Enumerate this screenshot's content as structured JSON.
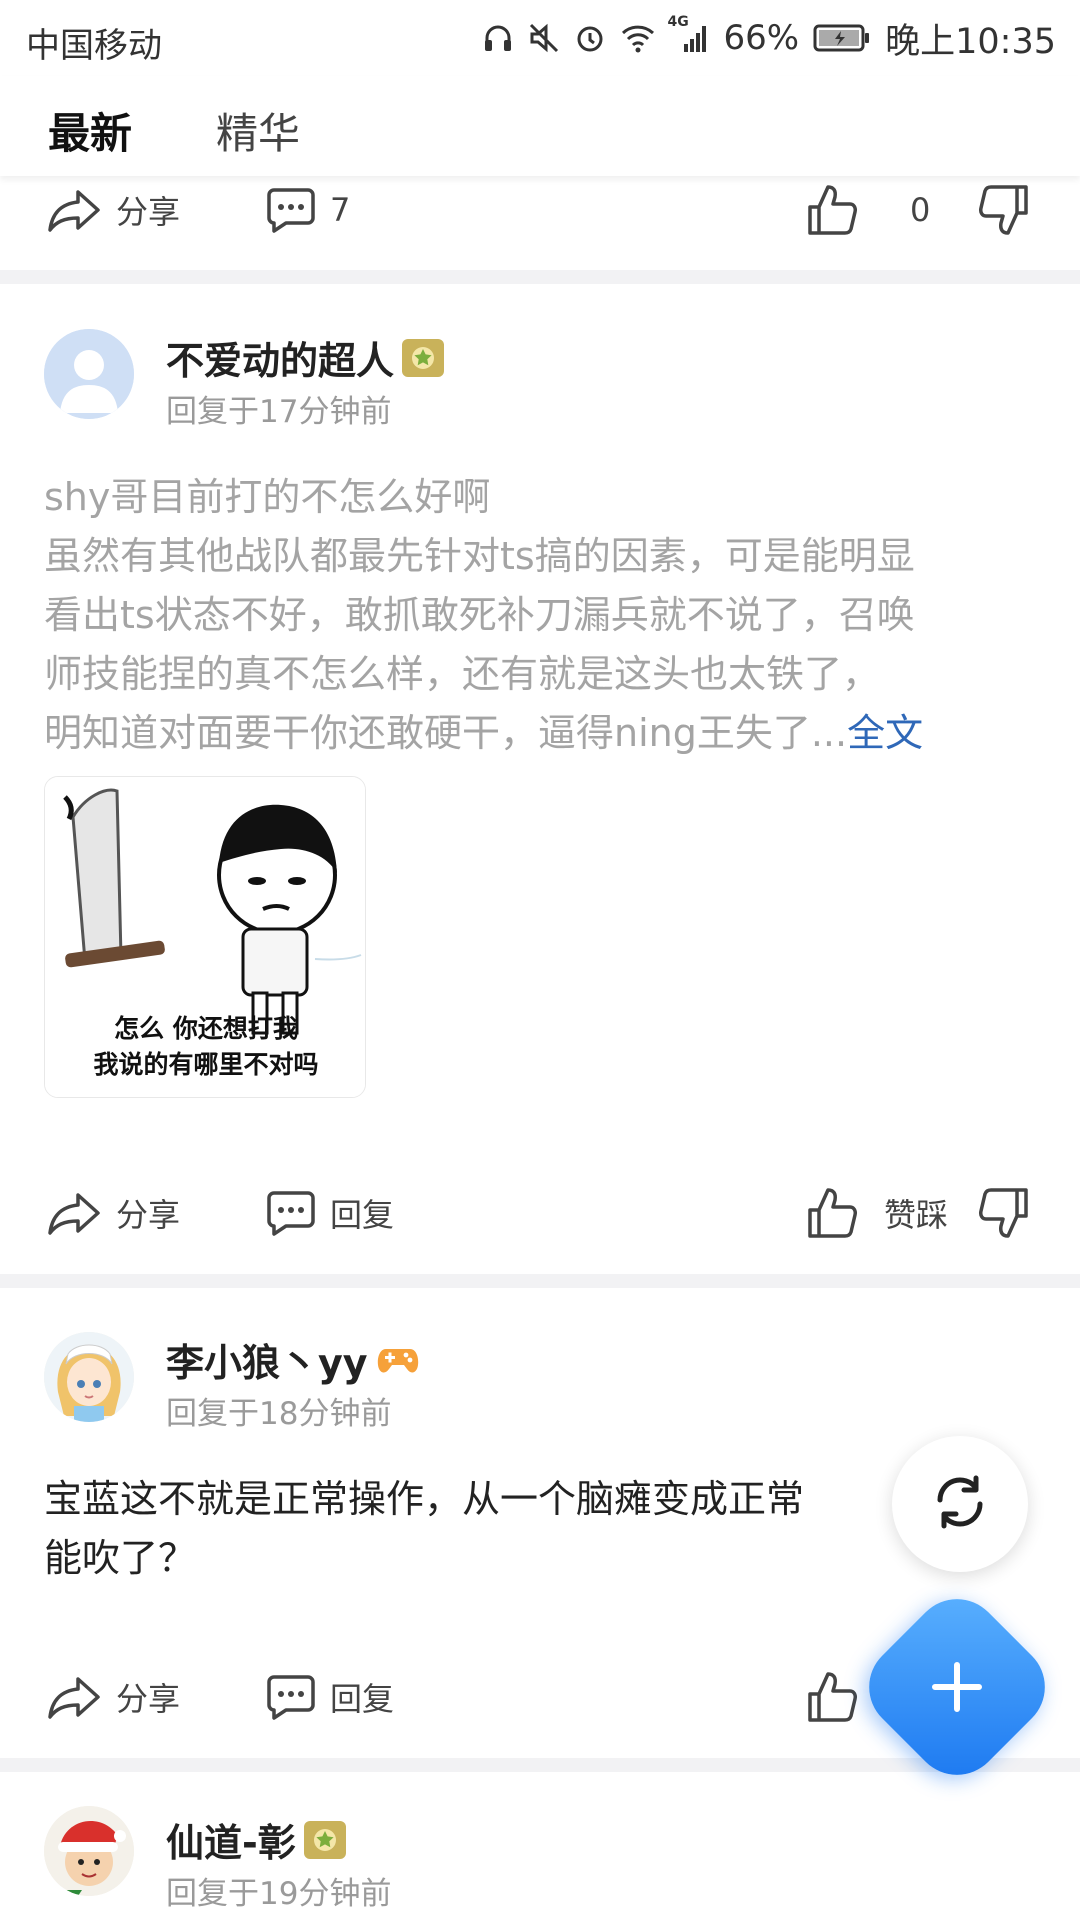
{
  "status_bar": {
    "carrier": "中国移动",
    "network": "4G",
    "battery": "66%",
    "time": "晚上10:35"
  },
  "tabs": [
    {
      "label": "最新",
      "active": true
    },
    {
      "label": "精华",
      "active": false
    }
  ],
  "prev_post_actions": {
    "share_label": "分享",
    "comment_count": "7",
    "like_count": "0"
  },
  "posts": [
    {
      "username": "不爱动的超人",
      "timestamp": "回复于17分钟前",
      "text_lines": [
        "shy哥目前打的不怎么好啊",
        "虽然有其他战队都最先针对ts搞的因素，可是能明显",
        "看出ts状态不好，敢抓敢死补刀漏兵就不说了，召唤",
        "师技能捏的真不怎么样，还有就是这头也太铁了，",
        "明知道对面要干你还敢硬干，逼得ning王失了..."
      ],
      "more_link": "全文",
      "image_caption": [
        "怎么 你还想打我",
        "我说的有哪里不对吗"
      ],
      "actions": {
        "share_label": "分享",
        "reply_label": "回复",
        "vote_label": "赞踩"
      }
    },
    {
      "username": "李小狼丶yy",
      "timestamp": "回复于18分钟前",
      "text_lines": [
        "宝蓝这不就是正常操作，从一个脑瘫变成正常",
        "能吹了？"
      ],
      "actions": {
        "share_label": "分享",
        "reply_label": "回复"
      }
    },
    {
      "username": "仙道-彰",
      "timestamp": "回复于19分钟前"
    }
  ],
  "colors": {
    "accent_blue": "#2f68b8",
    "fab_blue": "#1976f0",
    "badge_gold": "#c9b25a"
  }
}
